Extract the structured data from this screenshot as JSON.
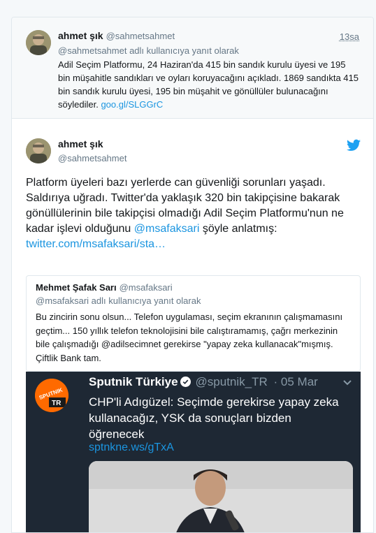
{
  "reply_tweet": {
    "name": "ahmet şık",
    "handle": "@sahmetsahmet",
    "time": "13sa",
    "replying_to": "@sahmetsahmet adlı kullanıcıya yanıt olarak",
    "text": "Adil Seçim Platformu, 24 Haziran'da 415 bin sandık kurulu üyesi ve 195 bin müşahitle sandıkları ve oyları koruyacağını açıkladı. 1869 sandıkta 415 bin sandık kurulu üyesi, 195 bin müşahit ve gönüllüler bulunacağını söylediler.",
    "link": "goo.gl/SLGGrC"
  },
  "main_tweet": {
    "name": "ahmet şık",
    "handle": "@sahmetsahmet",
    "bird_icon": "twitter-bird-icon",
    "text_part1": "Platform üyeleri bazı yerlerde can güvenliği sorunları yaşadı. Saldırıya uğradı. Twitter'da yaklaşık 320 bin takipçisine bakarak gönüllülerinin bile takipçisi olmadığı Adil Seçim Platformu'nun ne kadar işlevi olduğunu",
    "mention": "@msafaksari",
    "text_part2": "şöyle anlatmış:",
    "link": "twitter.com/msafaksari/sta…"
  },
  "quoted_tweet": {
    "name": "Mehmet Şafak Sarı",
    "handle": "@msafaksari",
    "replying_to": "@msafaksari adlı kullanıcıya yanıt olarak",
    "text": "Bu zincirin sonu olsun... Telefon uygulaması, seçim ekranının çalışmamasını geçtim... 150 yıllık telefon teknolojisini bile calıştıramamış, çağrı merkezinin bile çalışmadığı @adilsecimnet gerekirse \"yapay zeka kullanacak\"mışmış. Çiftlik Bank tam."
  },
  "embedded_image": {
    "logo_text": "SPUTNIK",
    "logo_sub": "TR",
    "account_name": "Sputnik Türkiye",
    "handle": "@sputnik_TR",
    "date": "· 05 Mar",
    "text": "CHP'li Adıgüzel: Seçimde gerekirse yapay zeka kullanacağız, YSK da sonuçları bizden öğrenecek",
    "link": "sptnkne.ws/gTxA"
  },
  "colors": {
    "link": "#1b95e0",
    "secondary_text": "#657786",
    "border": "#e1e8ed",
    "sputnik_orange": "#ff6a00",
    "embed_bg": "#1e2834"
  }
}
